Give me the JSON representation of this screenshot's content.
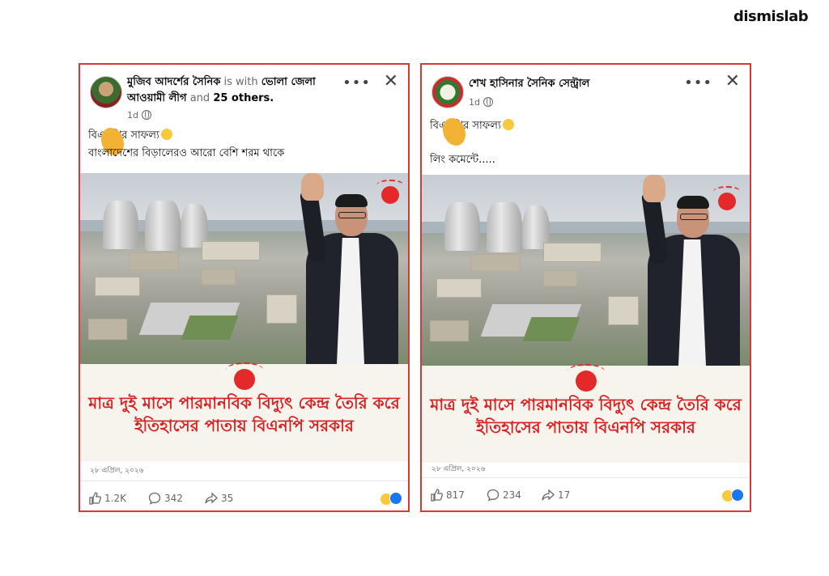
{
  "brand": "dismislab",
  "posts": [
    {
      "author": "মুজিব আদর্শের সৈনিক",
      "with_text": "is with",
      "tagged": "ভোলা জেলা আওয়ামী লীগ",
      "and_text": "and",
      "others": "25 others",
      "time": "1d",
      "line1": "বিএনপির সাফল্য",
      "line2": "বাংলাদেশের বিড়ালেরও আরো বেশি শরম থাকে",
      "headline": "মাত্র দুই মাসে পারমানবিক বিদ্যুৎ কেন্দ্র তৈরি করে ইতিহাসের পাতায় বিএনপি সরকার",
      "date": "২৮ এপ্রিল, ২০২৬",
      "likes": "1.2K",
      "comments": "342",
      "shares": "35"
    },
    {
      "author": "শেখ হাসিনার সৈনিক সেন্ট্রাল",
      "time": "1d",
      "line1": "বিএনপির সাফল্য",
      "line2": "লিং কমেন্টে.....",
      "headline": "মাত্র দুই মাসে পারমানবিক বিদ্যুৎ কেন্দ্র তৈরি করে ইতিহাসের পাতায় বিএনপি সরকার",
      "date": "২৮ এপ্রিল, ২০২৬",
      "likes": "817",
      "comments": "234",
      "shares": "17"
    }
  ],
  "icons": {
    "more": "more-options-icon",
    "close": "close-icon",
    "globe": "globe-icon",
    "like": "like-icon",
    "comment": "comment-icon",
    "share": "share-icon"
  },
  "colors": {
    "frame": "#d33a3a",
    "headline": "#d62222",
    "sun": "#e32929"
  }
}
